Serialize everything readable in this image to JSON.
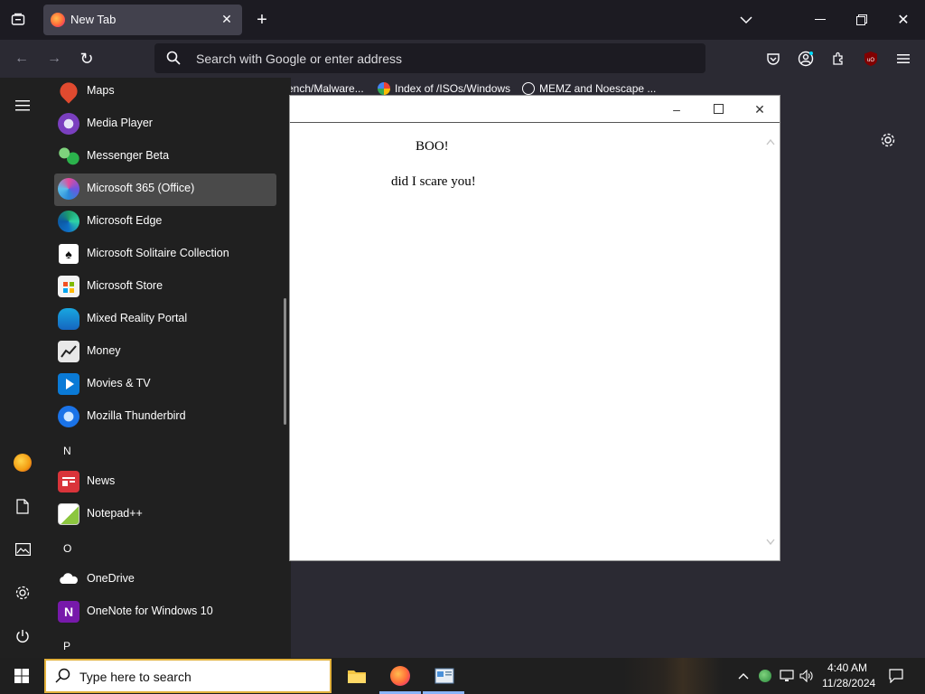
{
  "browser": {
    "tab_title": "New Tab",
    "url_placeholder": "Search with Google or enter address",
    "bookmarks": [
      "ench/Malware...",
      "Index of /ISOs/Windows",
      "MEMZ and Noescape ..."
    ]
  },
  "start_menu": {
    "apps": [
      {
        "label": "Maps",
        "color": "#e04a2f"
      },
      {
        "label": "Media Player",
        "color": "#7a3fbf"
      },
      {
        "label": "Messenger Beta",
        "color": "#2bb24c"
      },
      {
        "label": "Microsoft 365 (Office)",
        "color": "#6d55e0"
      },
      {
        "label": "Microsoft Edge",
        "color": "#1e9e6a"
      },
      {
        "label": "Microsoft Solitaire Collection",
        "color": "#ffffff"
      },
      {
        "label": "Microsoft Store",
        "color": "#f3f3f3"
      },
      {
        "label": "Mixed Reality Portal",
        "color": "#18a7e0"
      },
      {
        "label": "Money",
        "color": "#e8e8e8"
      },
      {
        "label": "Movies & TV",
        "color": "#0a7ad6"
      },
      {
        "label": "Mozilla Thunderbird",
        "color": "#1a73e8"
      }
    ],
    "letter_n": "N",
    "apps_n": [
      {
        "label": "News",
        "color": "#d9343a"
      },
      {
        "label": "Notepad++",
        "color": "#8cc63f"
      }
    ],
    "letter_o": "O",
    "apps_o": [
      {
        "label": "OneDrive",
        "color": "#ffffff"
      },
      {
        "label": "OneNote for Windows 10",
        "color": "#7719aa"
      }
    ],
    "letter_p": "P"
  },
  "popup": {
    "heading": "BOO!",
    "message": "did I scare you!"
  },
  "taskbar": {
    "search_placeholder": "Type here to search",
    "time": "4:40 AM",
    "date": "11/28/2024"
  }
}
